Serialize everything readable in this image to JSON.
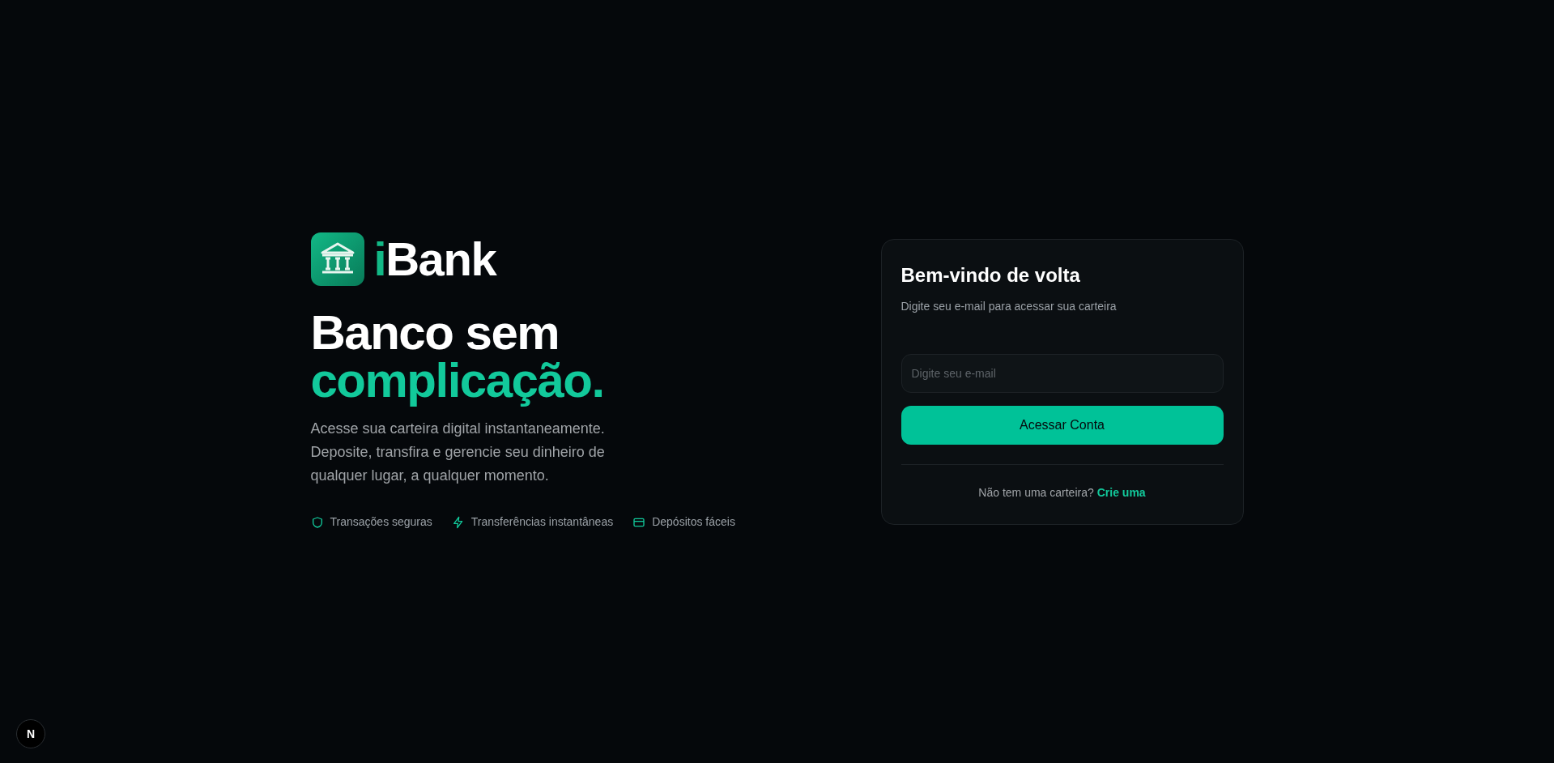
{
  "brand": {
    "accent": "i",
    "rest": "Bank"
  },
  "headline": {
    "line_1": "Banco sem",
    "line_2": "complicação."
  },
  "intro": "Acesse sua carteira digital instantaneamente. Deposite, transfira e gerencie seu dinheiro de qualquer lugar, a qualquer momento.",
  "features": [
    {
      "kind": "shield",
      "label": "Transações seguras"
    },
    {
      "kind": "bolt",
      "label": "Transferências instantâneas"
    },
    {
      "kind": "card",
      "label": "Depósitos fáceis"
    }
  ],
  "login_card": {
    "title": "Bem-vindo de volta",
    "subtitle": "Digite seu e-mail para acessar sua carteira",
    "email_field": {
      "placeholder": "Digite seu e-mail"
    },
    "submit_button": "Acessar Conta",
    "signup_prompt": "Não tem uma carteira?",
    "signup_link": "Crie uma"
  },
  "dev_badge": {
    "label": "N"
  }
}
